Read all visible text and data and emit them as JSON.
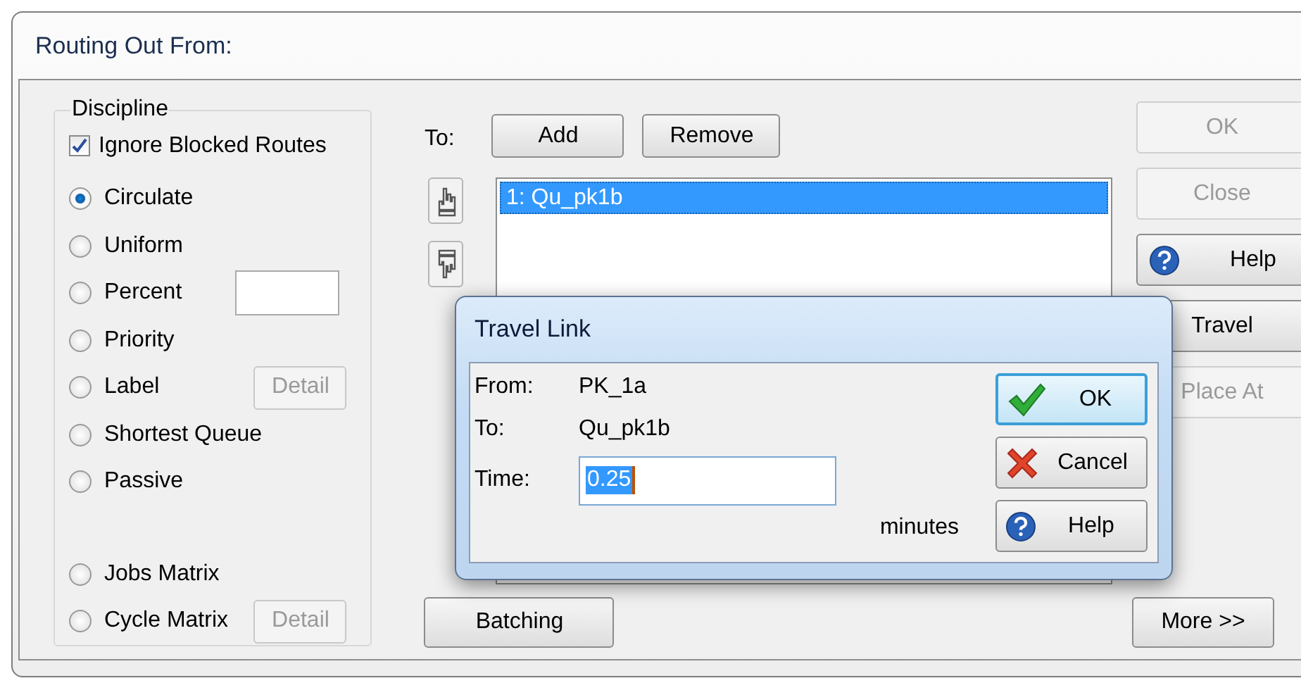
{
  "window": {
    "title": "Routing Out From:"
  },
  "discipline": {
    "title": "Discipline",
    "ignore_blocked": {
      "label": "Ignore Blocked Routes",
      "checked": true
    },
    "options": [
      {
        "label": "Circulate",
        "selected": true,
        "kind": "plain"
      },
      {
        "label": "Uniform",
        "selected": false,
        "kind": "plain"
      },
      {
        "label": "Percent",
        "selected": false,
        "kind": "field"
      },
      {
        "label": "Priority",
        "selected": false,
        "kind": "plain"
      },
      {
        "label": "Label",
        "selected": false,
        "kind": "detail",
        "button": {
          "label": "Detail",
          "disabled": true
        }
      },
      {
        "label": "Shortest Queue",
        "selected": false,
        "kind": "plain"
      },
      {
        "label": "Passive",
        "selected": false,
        "kind": "plain"
      }
    ],
    "matrix_options": [
      {
        "label": "Jobs Matrix",
        "selected": false,
        "kind": "plain"
      },
      {
        "label": "Cycle Matrix",
        "selected": false,
        "kind": "detail",
        "button": {
          "label": "Detail",
          "disabled": true
        }
      }
    ]
  },
  "to_label": "To:",
  "add_button": "Add",
  "remove_button": "Remove",
  "targets": [
    {
      "label": "1: Qu_pk1b",
      "selected": true
    }
  ],
  "batching_button": "Batching",
  "side_buttons": [
    {
      "label": "OK",
      "disabled": true,
      "kind": "plain"
    },
    {
      "label": "Close",
      "disabled": true,
      "kind": "plain"
    },
    {
      "label": "Help",
      "disabled": false,
      "kind": "help"
    },
    {
      "label": "Travel",
      "disabled": false,
      "kind": "plain"
    },
    {
      "label": "Place At",
      "disabled": true,
      "kind": "plain"
    }
  ],
  "more_button": "More >>",
  "dialog": {
    "title": "Travel Link",
    "from_label": "From:",
    "from_value": "PK_1a",
    "to_label": "To:",
    "to_value": "Qu_pk1b",
    "time_label": "Time:",
    "time_value": "0.25",
    "time_selected": true,
    "unit": "minutes",
    "buttons": [
      {
        "label": "OK",
        "kind": "confirm",
        "default": true
      },
      {
        "label": "Cancel",
        "kind": "cancel",
        "default": false
      },
      {
        "label": "Help",
        "kind": "help",
        "default": false
      }
    ]
  }
}
